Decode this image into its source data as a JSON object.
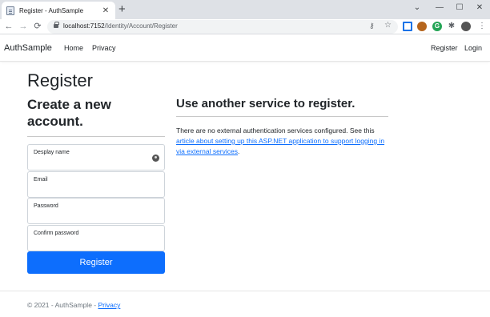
{
  "browser": {
    "tab_title": "Register - AuthSample",
    "tab_close": "✕",
    "new_tab": "+",
    "url_host": "localhost:7152",
    "url_path": "/Identity/Account/Register",
    "controls": {
      "chevron": "⌄",
      "minimize": "—",
      "maximize": "☐",
      "close": "✕"
    },
    "nav": {
      "back": "←",
      "forward": "→",
      "reload": "⟳"
    },
    "icons": {
      "key": "key-icon",
      "star": "star-icon"
    }
  },
  "navbar": {
    "brand": "AuthSample",
    "links": [
      "Home",
      "Privacy"
    ],
    "right_links": [
      "Register",
      "Login"
    ]
  },
  "page": {
    "title": "Register",
    "subtitle": "Create a new account.",
    "fields": {
      "name": {
        "label": "Desplay name",
        "value": ""
      },
      "email": {
        "label": "Email",
        "value": ""
      },
      "password": {
        "label": "Password",
        "value": ""
      },
      "confirm": {
        "label": "Confirm password",
        "value": ""
      }
    },
    "submit_label": "Register"
  },
  "external": {
    "title": "Use another service to register.",
    "text_before": "There are no external authentication services configured. See this ",
    "link_text": "article about setting up this ASP.NET application to support logging in via external services",
    "text_after": "."
  },
  "footer": {
    "text": "© 2021 - AuthSample - ",
    "link": "Privacy"
  },
  "colors": {
    "primary": "#0d6efd",
    "text": "#212529",
    "muted": "#6c757d"
  }
}
